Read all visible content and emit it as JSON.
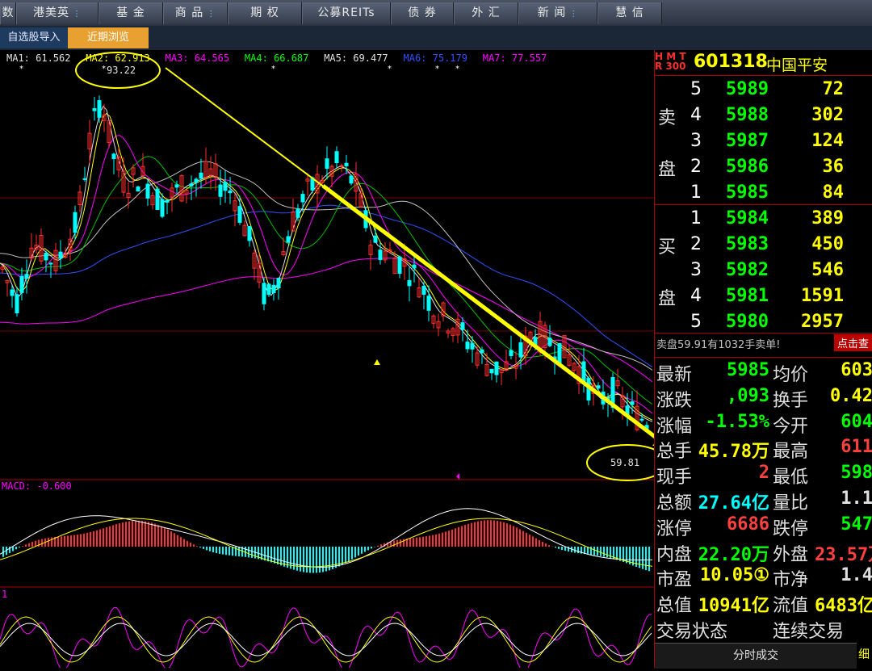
{
  "nav": {
    "tabs": [
      "数",
      "港美英",
      "基 金",
      "商 品",
      "期 权",
      "公募REITs",
      "债 券",
      "外 汇",
      "新 闻",
      "慧 信"
    ],
    "has_menu": [
      false,
      true,
      false,
      true,
      false,
      false,
      false,
      false,
      true,
      false
    ]
  },
  "subnav": {
    "import_label": "自选股导入",
    "recent_label": "近期浏览"
  },
  "ma_bar": {
    "items": [
      {
        "label": "MA1: 61.562",
        "color": "#e0e0e0"
      },
      {
        "label": "MA2: 62.913",
        "color": "#ffff00"
      },
      {
        "label": "MA3: 64.565",
        "color": "#ff00ff"
      },
      {
        "label": "MA4: 66.687",
        "color": "#00ff00"
      },
      {
        "label": "MA5: 69.477",
        "color": "#e0e0e0"
      },
      {
        "label": "MA6: 75.179",
        "color": "#3050ff"
      },
      {
        "label": "MA7: 77.557",
        "color": "#ff00ff"
      }
    ]
  },
  "annotations": {
    "high_label": "93.22",
    "low_label": "59.81"
  },
  "macd_label": "MACD: -0.600",
  "kdj_label": "1",
  "chart_data": {
    "type": "candlestick",
    "title": "",
    "high_marker": 93.22,
    "low_marker": 59.81,
    "moving_averages": [
      {
        "name": "MA1",
        "value": 61.562
      },
      {
        "name": "MA2",
        "value": 62.913
      },
      {
        "name": "MA3",
        "value": 64.565
      },
      {
        "name": "MA4",
        "value": 66.687
      },
      {
        "name": "MA5",
        "value": 69.477
      },
      {
        "name": "MA6",
        "value": 75.179
      },
      {
        "name": "MA7",
        "value": 77.557
      }
    ],
    "macd": -0.6,
    "trend_line": {
      "from": 93.22,
      "to": 59.81,
      "direction": "down"
    }
  },
  "quote": {
    "badge": "H M T R 300",
    "code": "601318",
    "name": "中国平安",
    "sell_label_1": "卖",
    "sell_label_2": "盘",
    "buy_label_1": "买",
    "buy_label_2": "盘",
    "asks": [
      {
        "level": "5",
        "price": "5989",
        "vol": "72"
      },
      {
        "level": "4",
        "price": "5988",
        "vol": "302"
      },
      {
        "level": "3",
        "price": "5987",
        "vol": "124"
      },
      {
        "level": "2",
        "price": "5986",
        "vol": "36"
      },
      {
        "level": "1",
        "price": "5985",
        "vol": "84"
      }
    ],
    "bids": [
      {
        "level": "1",
        "price": "5984",
        "vol": "389"
      },
      {
        "level": "2",
        "price": "5983",
        "vol": "450"
      },
      {
        "level": "3",
        "price": "5982",
        "vol": "546"
      },
      {
        "level": "4",
        "price": "5981",
        "vol": "1591"
      },
      {
        "level": "5",
        "price": "5980",
        "vol": "2957"
      }
    ],
    "notice": "卖盘59.91有1032手卖单!",
    "notice_btn": "点击查",
    "stats": [
      {
        "l1": "最新",
        "v1": "5985",
        "c1": "#00ff00",
        "l2": "均价",
        "v2": "603",
        "c2": "#ffff00"
      },
      {
        "l1": "涨跌",
        "v1": ",093",
        "c1": "#00ff00",
        "l2": "换手",
        "v2": "0.42",
        "c2": "#ffff00"
      },
      {
        "l1": "涨幅",
        "v1": "-1.53%",
        "c1": "#00ff00",
        "l2": "今开",
        "v2": "604",
        "c2": "#00ff00"
      },
      {
        "l1": "总手",
        "v1": "45.78万",
        "c1": "#ffff00",
        "l2": "最高",
        "v2": "611",
        "c2": "#ff4040"
      },
      {
        "l1": "现手",
        "v1": "2",
        "c1": "#ff4040",
        "l2": "最低",
        "v2": "598",
        "c2": "#00ff00"
      },
      {
        "l1": "总额",
        "v1": "27.64亿",
        "c1": "#00ffff",
        "l2": "量比",
        "v2": "1.1",
        "c2": "#e0e0e0"
      },
      {
        "l1": "涨停",
        "v1": "6686",
        "c1": "#ff4040",
        "l2": "跌停",
        "v2": "547",
        "c2": "#00ff00"
      },
      {
        "l1": "内盘",
        "v1": "22.20万",
        "c1": "#00ff00",
        "l2": "外盘",
        "v2": "23.57万",
        "c2": "#ff4040"
      },
      {
        "l1": "市盈",
        "v1": "10.05①",
        "c1": "#ffff00",
        "l2": "市净",
        "v2": "1.4",
        "c2": "#e0e0e0"
      },
      {
        "l1": "总值",
        "v1": "10941亿",
        "c1": "#ffff00",
        "l2": "流值",
        "v2": "6483亿",
        "c2": "#ffff00"
      },
      {
        "l1": "交易状态",
        "v1": "",
        "c1": "#e0e0e0",
        "l2": "连续交易",
        "v2": "",
        "c2": "#e0e0e0"
      }
    ],
    "bottom_tab": "分时成交",
    "bottom_tab2": "细"
  },
  "colors": {
    "up": "#ff3030",
    "down": "#00ffff",
    "annotation": "#ffff00"
  }
}
